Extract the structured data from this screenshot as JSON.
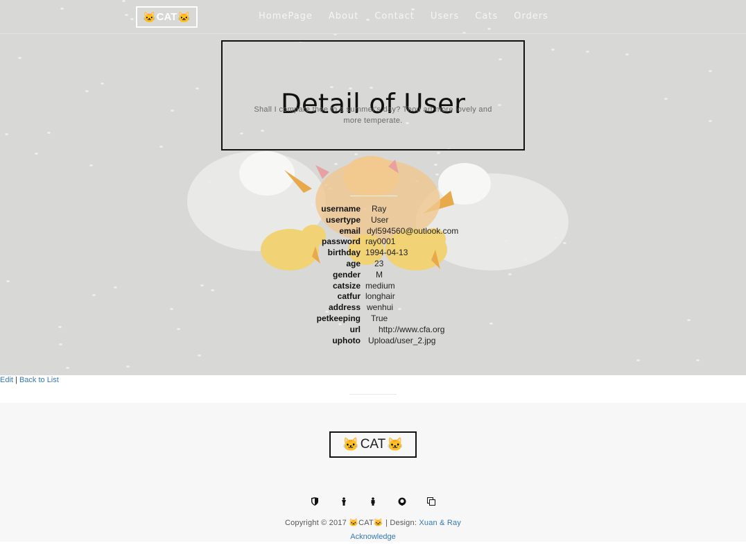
{
  "brand": {
    "logo_text": "CAT",
    "emoji": "🐱"
  },
  "nav": {
    "items": [
      "HomePage",
      "About",
      "Contact",
      "Users",
      "Cats",
      "Orders"
    ]
  },
  "header": {
    "title": "Detail of User",
    "subtitle": "Shall I compare thee to a summer's day? Thou art more lovely and more temperate."
  },
  "details": [
    {
      "key": "username",
      "value": "Ray"
    },
    {
      "key": "usertype",
      "value": "User"
    },
    {
      "key": "email",
      "value": "dyl594560@outlook.com"
    },
    {
      "key": "password",
      "value": "ray0001"
    },
    {
      "key": "birthday",
      "value": "1994-04-13"
    },
    {
      "key": "age",
      "value": "23"
    },
    {
      "key": "gender",
      "value": "M"
    },
    {
      "key": "catsize",
      "value": "medium"
    },
    {
      "key": "catfur",
      "value": "longhair"
    },
    {
      "key": "address",
      "value": "wenhui"
    },
    {
      "key": "petkeeping",
      "value": "True"
    },
    {
      "key": "url",
      "value": "http://www.cfa.org"
    },
    {
      "key": "uphoto",
      "value": "Upload/user_2.jpg"
    }
  ],
  "actions": {
    "edit": "Edit",
    "separator": "|",
    "back": "Back to List"
  },
  "footer": {
    "social_icons": [
      "shield-icon",
      "person-icon",
      "person-icon",
      "github-icon",
      "copy-icon"
    ],
    "copyright_prefix": "Copyright © 2017",
    "design_label": "| Design:",
    "designers": "Xuan & Ray",
    "acknowledge": "Acknowledge"
  },
  "colors": {
    "hero_bg": "#d8d8d6",
    "link": "#337ab7",
    "footer_bg": "#f7f7f7"
  }
}
